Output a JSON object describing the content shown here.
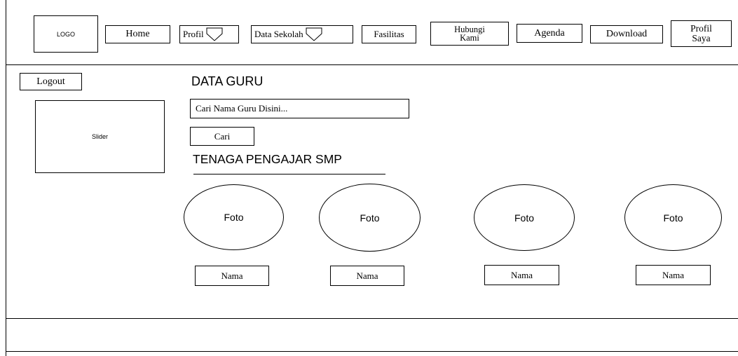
{
  "header": {
    "logo": "LOGO",
    "nav": {
      "home": "Home",
      "profil": "Profil",
      "data_sekolah": "Data Sekolah",
      "fasilitas": "Fasilitas",
      "hubungi_line1": "Hubungi",
      "hubungi_line2": "Kami",
      "agenda": "Agenda",
      "download": "Download",
      "profil_saya_line1": "Profil",
      "profil_saya_line2": "Saya"
    }
  },
  "sidebar": {
    "logout": "Logout",
    "slider": "Slider"
  },
  "main": {
    "title": "DATA GURU",
    "search": {
      "value": "Cari Nama Guru Disini..."
    },
    "search_button": "Cari",
    "section_title": "TENAGA PENGAJAR SMP",
    "teachers": [
      {
        "photo": "Foto",
        "name": "Nama"
      },
      {
        "photo": "Foto",
        "name": "Nama"
      },
      {
        "photo": "Foto",
        "name": "Nama"
      },
      {
        "photo": "Foto",
        "name": "Nama"
      }
    ]
  }
}
